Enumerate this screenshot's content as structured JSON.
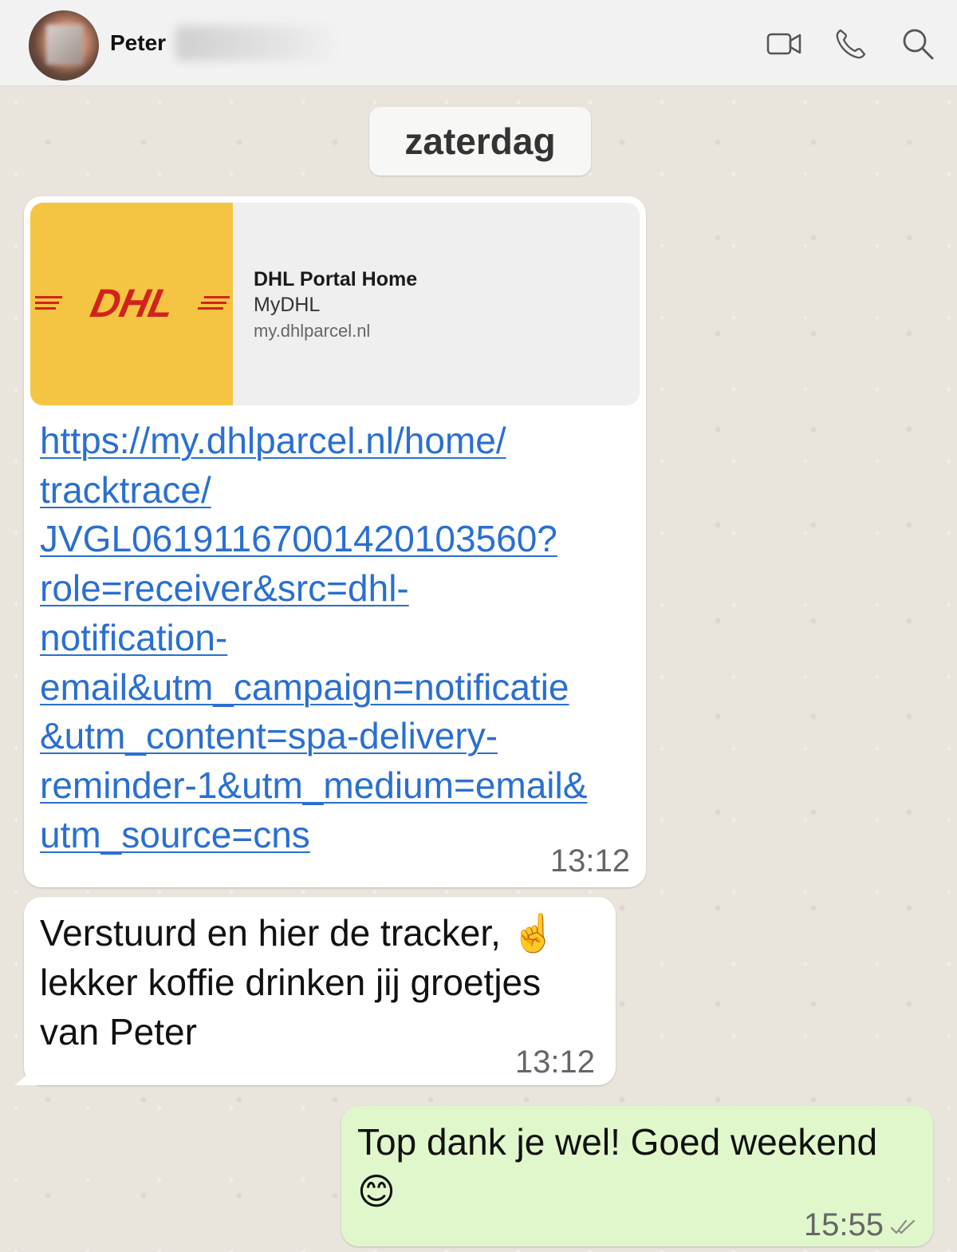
{
  "header": {
    "contact_name": "Peter",
    "icons": [
      "video-call-icon",
      "phone-call-icon",
      "search-icon"
    ]
  },
  "chat": {
    "date_separator": "zaterdag",
    "messages": [
      {
        "direction": "incoming",
        "link_preview": {
          "logo_text": "DHL",
          "title": "DHL Portal Home",
          "subtitle": "MyDHL",
          "domain": "my.dhlparcel.nl"
        },
        "link_lines": [
          "https://my.dhlparcel.nl/home/",
          "tracktrace/",
          "JVGL06191167001420103560?",
          "role=receiver&src=dhl-",
          "notification-",
          "email&utm_campaign=notificatie",
          "&utm_content=spa-delivery-",
          "reminder-1&utm_medium=email&",
          "utm_source=cns"
        ],
        "time": "13:12"
      },
      {
        "direction": "incoming",
        "text_lines": [
          "Verstuurd en hier de tracker, ☝️",
          "lekker koffie drinken jij groetjes",
          "van Peter"
        ],
        "time": "13:12"
      },
      {
        "direction": "outgoing",
        "text_lines": [
          "Top dank je wel! Goed weekend",
          "😊"
        ],
        "time": "15:55",
        "status": "read"
      }
    ]
  },
  "colors": {
    "header_bg": "#f2f2f2",
    "chat_bg": "#e9e4dc",
    "incoming_bubble": "#ffffff",
    "outgoing_bubble": "#e0f7cb",
    "link": "#2a6fd1",
    "dhl_yellow": "#f5c443",
    "dhl_red": "#d1231d"
  }
}
